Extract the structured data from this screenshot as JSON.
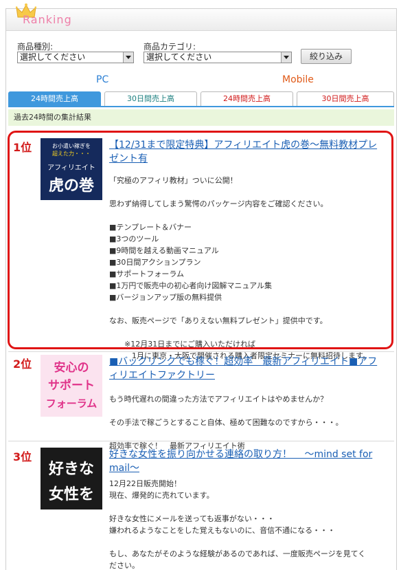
{
  "header": {
    "logo_text": "Ranking"
  },
  "filter": {
    "type_label": "商品種別:",
    "type_value": "選択してください",
    "category_label": "商品カテゴリ:",
    "category_value": "選択してください",
    "submit_label": "絞り込み"
  },
  "platforms": {
    "pc": "PC",
    "mobile": "Mobile"
  },
  "tabs": [
    {
      "label": "24時間売上高"
    },
    {
      "label": "30日間売上高"
    },
    {
      "label": "24時間売上高"
    },
    {
      "label": "30日間売上高"
    }
  ],
  "period_text": "過去24時間の集計結果",
  "items": [
    {
      "rank": "1位",
      "thumb_lines": [
        "お小遣い稼ぎを",
        "超えた力・・・",
        "アフィリエイト",
        "虎の巻"
      ],
      "title": "【12/31まで限定特典】アフィリエイト虎の巻〜無料教材プレゼント有",
      "desc": "「究極のアフィリ教材」ついに公開！\n\n思わず納得してしまう驚愕のパッケージ内容をご確認ください。\n\n■テンプレート＆バナー\n■3つのツール\n■9時間を越える動画マニュアル\n■30日間アクションプラン\n■サポートフォーラム\n■1万円で販売中の初心者向け図解マニュアル集\n■バージョンアップ版の無料提供\n\nなお、販売ページで「ありえない無料プレゼント」提供中です。\n\n　　※12月31日までにご購入いただければ\n　　　1月に東京・大阪で開催される購入者限定セミナーに無料招待します。"
    },
    {
      "rank": "2位",
      "thumb_lines": [
        "安心の",
        "サポート",
        "フォーラム"
      ],
      "title": "■バックリンクでも稼ぐ！超効率　最新アフィリエイト■アフィリエイトファクトリー",
      "desc": "もう時代遅れの間違った方法でアフィリエイトはやめませんか？\n\nその手法で稼ごうとすること自体、極めて困難なのですから・・・。\n\n超効率で稼ぐ！　最新アフィリエイト術"
    },
    {
      "rank": "3位",
      "thumb_lines": [
        "好きな",
        "女性を"
      ],
      "title": "好きな女性を振り向かせる連絡の取り方！　 〜mind set for mail〜",
      "desc": "12月22日販売開始！\n現在、爆発的に売れています。\n\n好きな女性にメールを送っても返事がない・・・\n嫌われるようなことをした覚えもないのに、音信不通になる・・・\n\nもし、あなたがそのような経験があるのであれば、一度販売ページを見てく\nださい。"
    }
  ]
}
